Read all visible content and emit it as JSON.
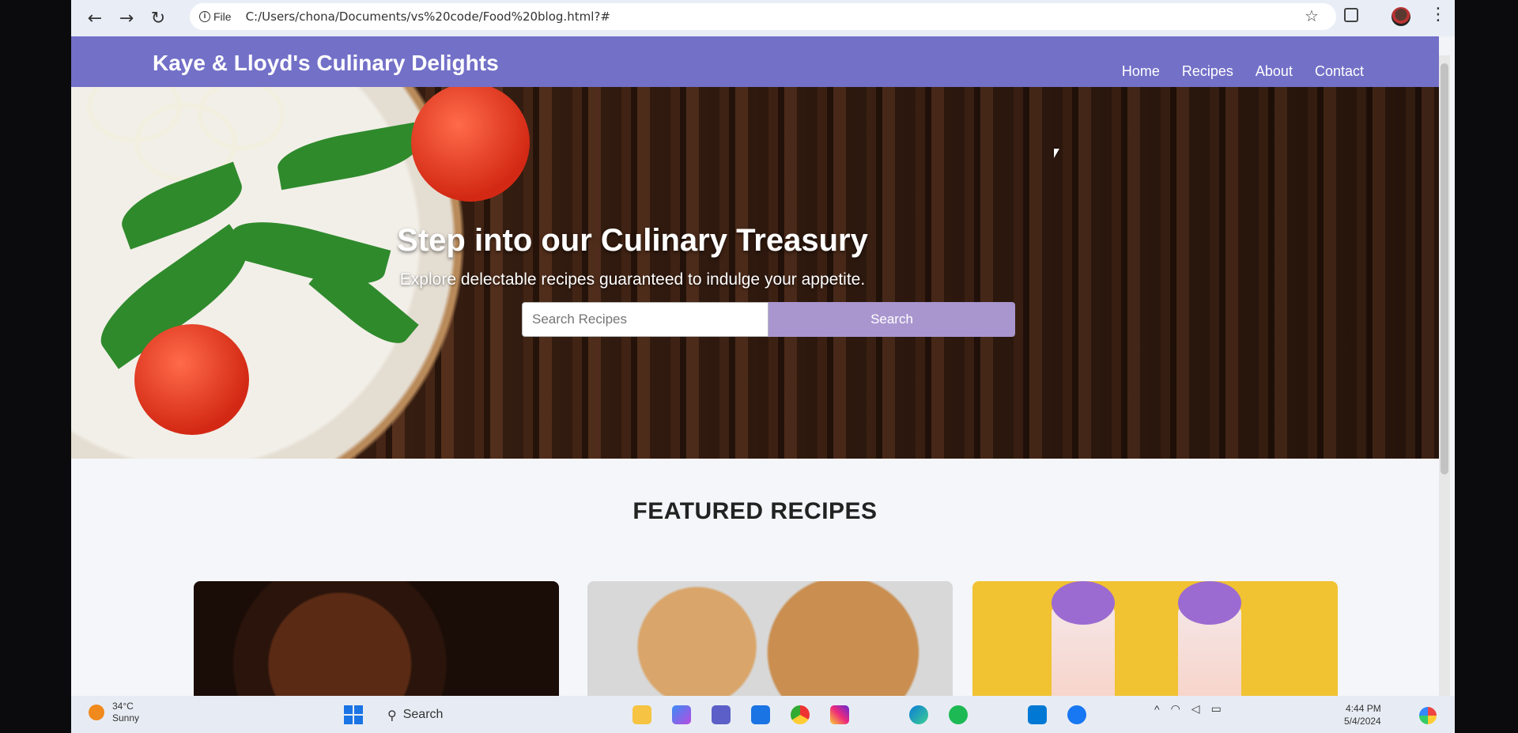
{
  "browser": {
    "file_label": "File",
    "url": "C:/Users/chona/Documents/vs%20code/Food%20blog.html?#"
  },
  "site": {
    "brand": "Kaye & Lloyd's Culinary Delights",
    "nav": [
      {
        "label": "Home"
      },
      {
        "label": "Recipes"
      },
      {
        "label": "About"
      },
      {
        "label": "Contact"
      }
    ]
  },
  "hero": {
    "title": "Step into our Culinary Treasury",
    "subtitle": "Explore delectable recipes guaranteed to indulge your appetite.",
    "search_placeholder": "Search Recipes",
    "search_button": "Search"
  },
  "featured": {
    "title": "FEATURED RECIPES"
  },
  "taskbar": {
    "weather_temp": "34°C",
    "weather_desc": "Sunny",
    "search_label": "Search",
    "time": "4:44 PM",
    "date": "5/4/2024"
  },
  "colors": {
    "header": "#7370c8",
    "search_button": "#a996cf"
  },
  "icons": [
    "back-icon",
    "forward-icon",
    "reload-icon",
    "info-icon",
    "star-icon",
    "extensions-icon",
    "profile-avatar",
    "menu-icon",
    "windows-start-icon",
    "search-icon"
  ]
}
